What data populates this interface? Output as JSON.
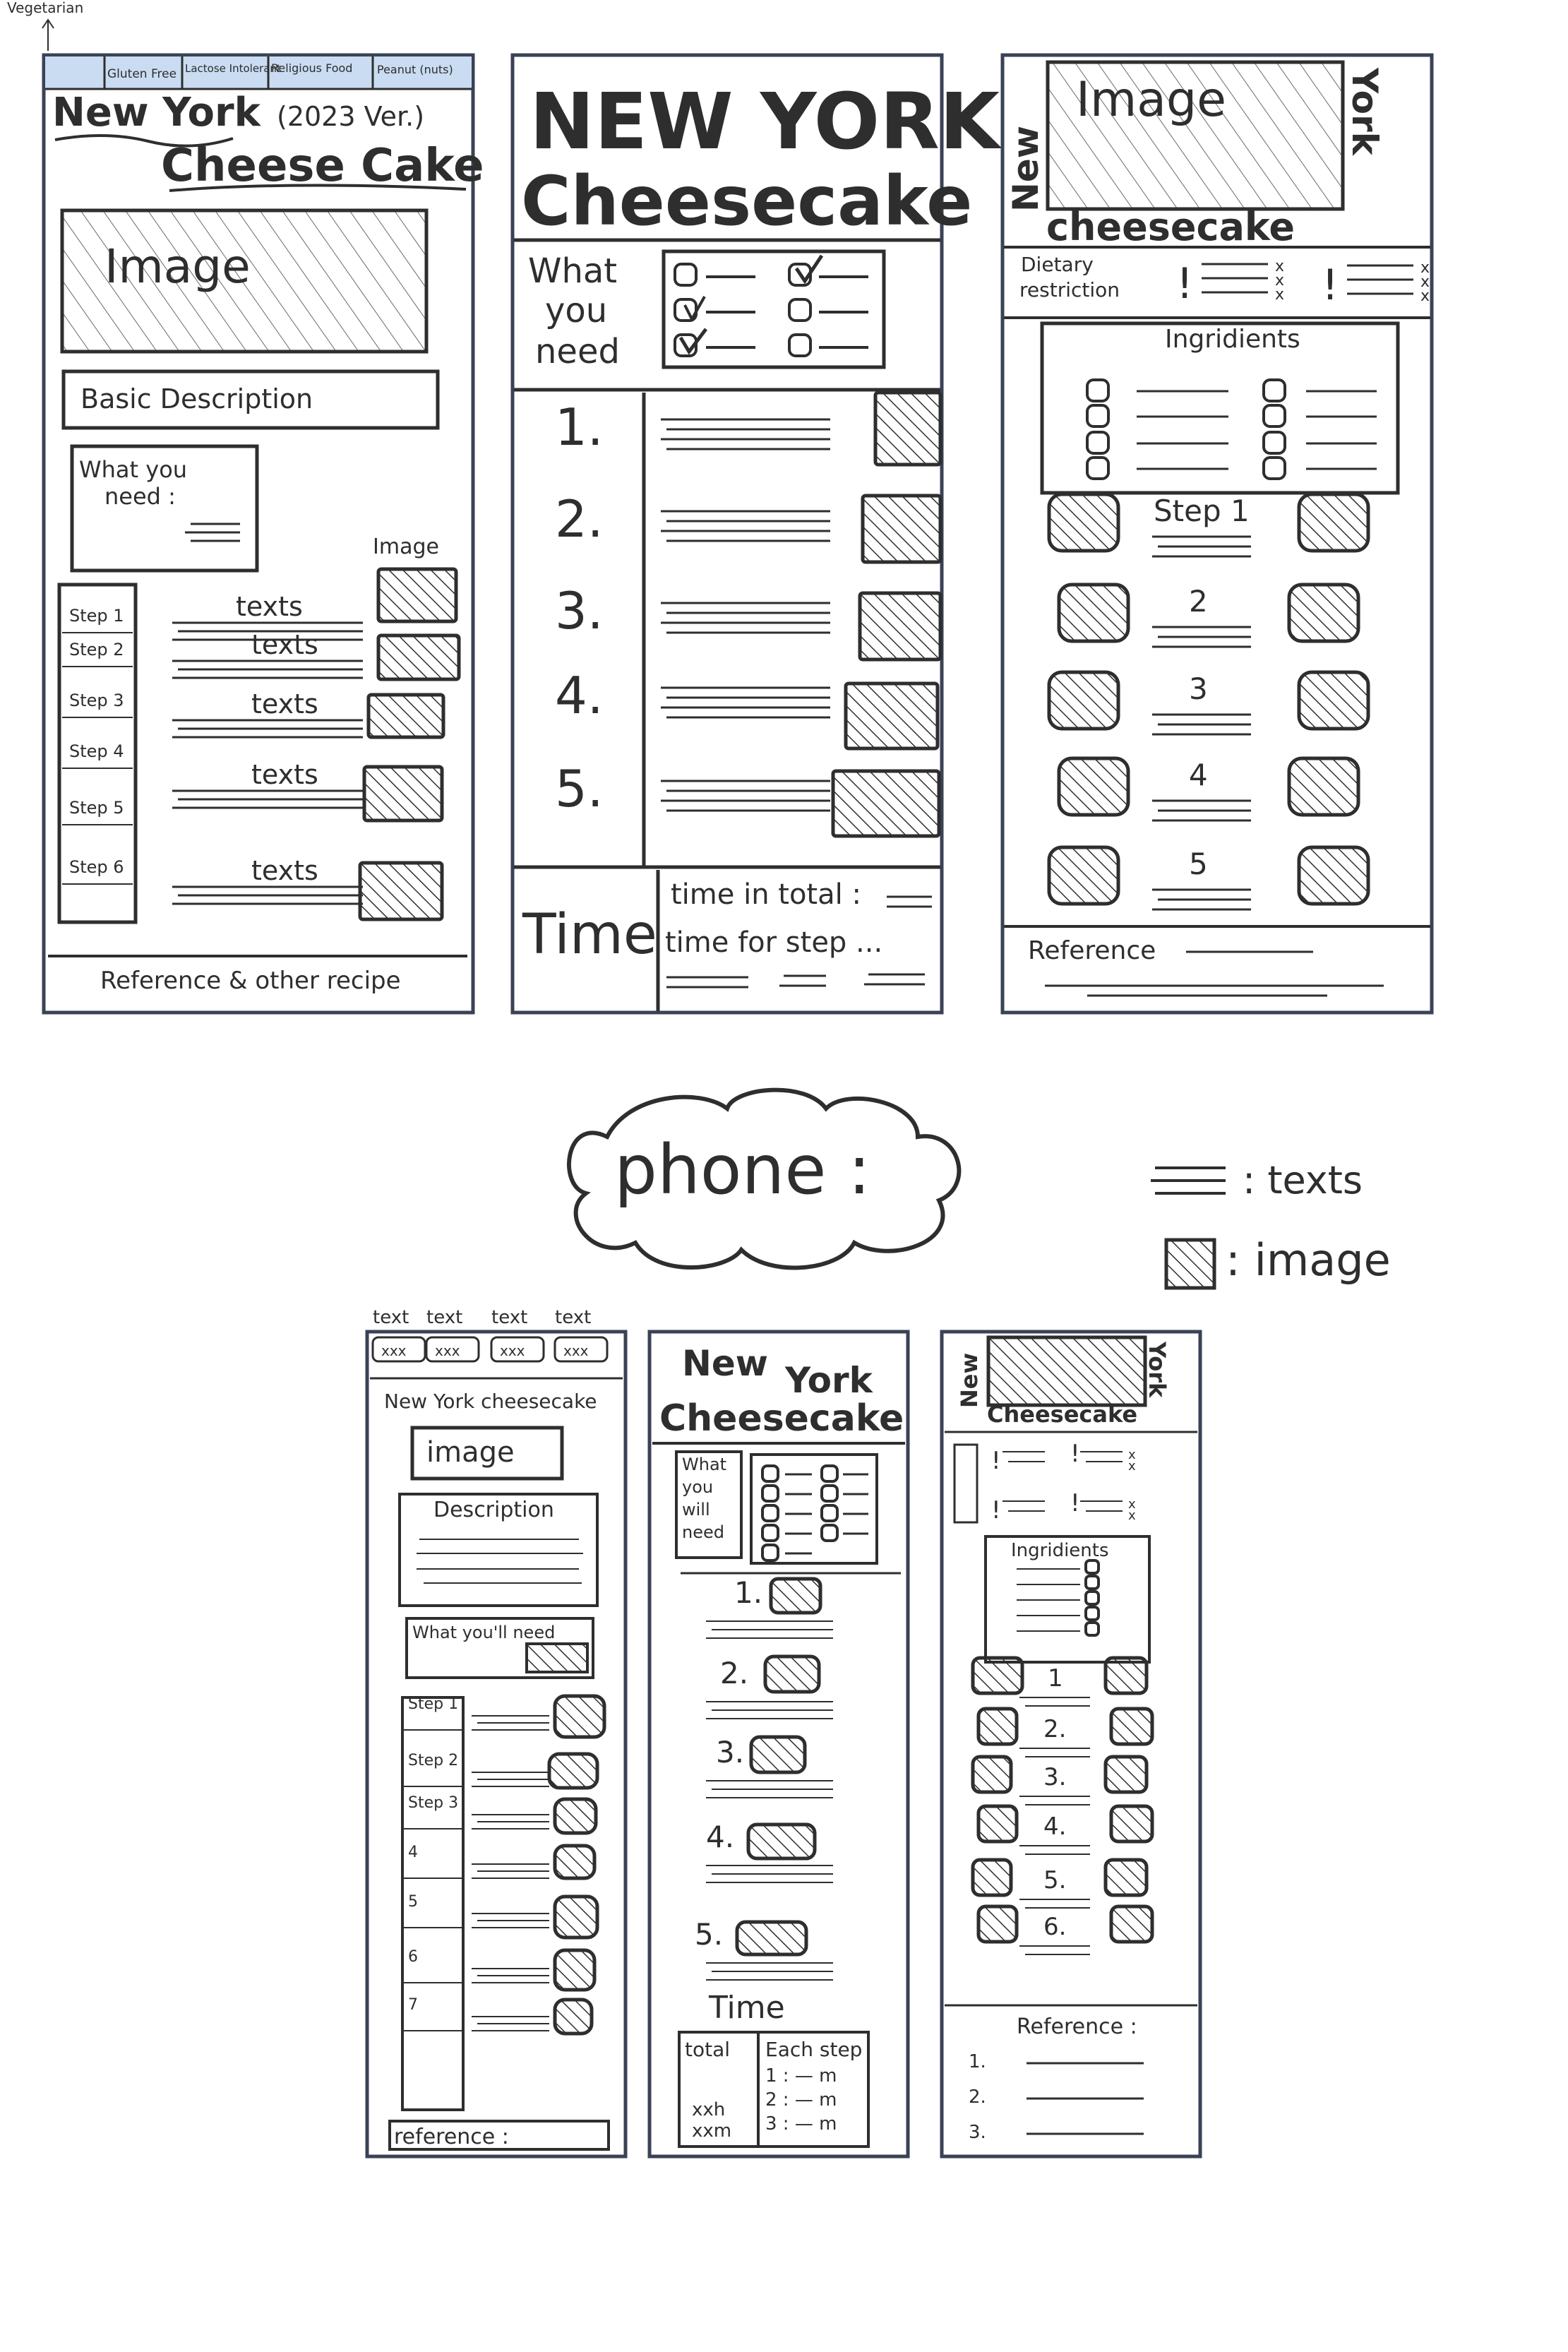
{
  "colors": {
    "ink": "#2e2e2e",
    "frame": "#3a4256",
    "tab_blue": "#c9dcf2"
  },
  "legend_icons": {
    "texts": "three-lines-icon",
    "image": "hatched-box-icon"
  },
  "top": {
    "w1": {
      "vegetarian": "Vegetarian",
      "tabs": [
        "Gluten Free",
        "Lactose Intolerant",
        "Religious Food",
        "Peanut (nuts)"
      ],
      "title1": "New York",
      "ver": "(2023 Ver.)",
      "title2": "Cheese Cake",
      "image": "Image",
      "basic": "Basic Description",
      "need1": "What you",
      "need2": "need :",
      "image_label": "Image",
      "steps": [
        "Step 1",
        "Step 2",
        "Step 3",
        "Step 4",
        "Step 5",
        "Step 6"
      ],
      "texts": "texts",
      "footer": "Reference & other recipe"
    },
    "w2": {
      "title1": "NEW YORK",
      "title2": "Cheesecake",
      "need": [
        "What",
        "you",
        "need"
      ],
      "steps": [
        "1.",
        "2.",
        "3.",
        "4.",
        "5."
      ],
      "time": "Time",
      "total": "time in total :",
      "per_step": "time for step ..."
    },
    "w3": {
      "new": "New",
      "york": "York",
      "image": "Image",
      "cheese": "cheesecake",
      "diet1": "Dietary",
      "diet2": "restriction",
      "ingredients": "Ingridients",
      "steps": [
        "Step 1",
        "2",
        "3",
        "4",
        "5"
      ],
      "reference": "Reference"
    }
  },
  "phone_label": "phone :",
  "legend": {
    "texts": ": texts",
    "image": ": image"
  },
  "bottom": {
    "p1": {
      "tabs": [
        "text",
        "text",
        "text",
        "text"
      ],
      "title": "New York  cheesecake",
      "image": "image",
      "description": "Description",
      "need": "What you'll need",
      "steps": [
        "Step 1",
        "Step 2",
        "Step 3",
        "4",
        "5",
        "6",
        "7"
      ],
      "reference": "reference : "
    },
    "p2": {
      "title1": "New",
      "title2": "York",
      "title3": "Cheesecake",
      "need": [
        "What",
        "you",
        "will",
        "need"
      ],
      "steps": [
        "1.",
        "2.",
        "3.",
        "4.",
        "5."
      ],
      "time": "Time",
      "total": "total",
      "total_val": [
        "xxh",
        "xxm"
      ],
      "each": "Each step",
      "each_rows": [
        "1 : — m",
        "2 : — m",
        "3 : — m"
      ]
    },
    "p3": {
      "new": "New",
      "york": "York",
      "cheese": "Cheesecake",
      "ingredients": "Ingridients",
      "steps": [
        "1",
        "2.",
        "3.",
        "4.",
        "5.",
        "6."
      ],
      "reference": "Reference :",
      "refs": [
        "1.",
        "2.",
        "3."
      ]
    }
  }
}
